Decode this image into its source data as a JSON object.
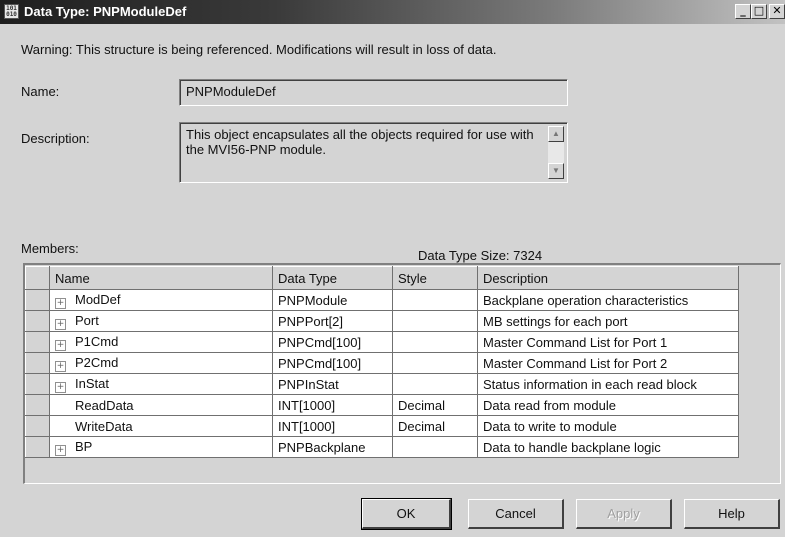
{
  "window": {
    "icon_text": "101\n010",
    "title": "Data Type: PNPModuleDef",
    "minimize_glyph": "_",
    "maximize_glyph": "□",
    "close_glyph": "✕"
  },
  "warning": "Warning: This structure is being referenced.  Modifications will result in loss of data.",
  "name": {
    "label": "Name:",
    "value": "PNPModuleDef"
  },
  "description": {
    "label": "Description:",
    "value": "This object encapsulates all the objects required for use with the MVI56-PNP module."
  },
  "members": {
    "label": "Members:",
    "data_type_size": "Data Type Size: 7324",
    "columns": {
      "name": "Name",
      "data_type": "Data Type",
      "style": "Style",
      "description": "Description"
    },
    "rows": [
      {
        "expandable": true,
        "name": "ModDef",
        "data_type": "PNPModule",
        "style": "",
        "description": "Backplane operation characteristics"
      },
      {
        "expandable": true,
        "name": "Port",
        "data_type": "PNPPort[2]",
        "style": "",
        "description": "MB settings for each port"
      },
      {
        "expandable": true,
        "name": "P1Cmd",
        "data_type": "PNPCmd[100]",
        "style": "",
        "description": "Master Command List for Port 1"
      },
      {
        "expandable": true,
        "name": "P2Cmd",
        "data_type": "PNPCmd[100]",
        "style": "",
        "description": "Master Command List for Port 2"
      },
      {
        "expandable": true,
        "name": "InStat",
        "data_type": "PNPInStat",
        "style": "",
        "description": "Status information in each read block"
      },
      {
        "expandable": false,
        "name": "ReadData",
        "data_type": "INT[1000]",
        "style": "Decimal",
        "description": "Data read from module"
      },
      {
        "expandable": false,
        "name": "WriteData",
        "data_type": "INT[1000]",
        "style": "Decimal",
        "description": "Data to write to module"
      },
      {
        "expandable": true,
        "name": "BP",
        "data_type": "PNPBackplane",
        "style": "",
        "description": "Data to handle backplane logic"
      }
    ]
  },
  "buttons": {
    "ok": "OK",
    "cancel": "Cancel",
    "apply": "Apply",
    "help": "Help"
  }
}
